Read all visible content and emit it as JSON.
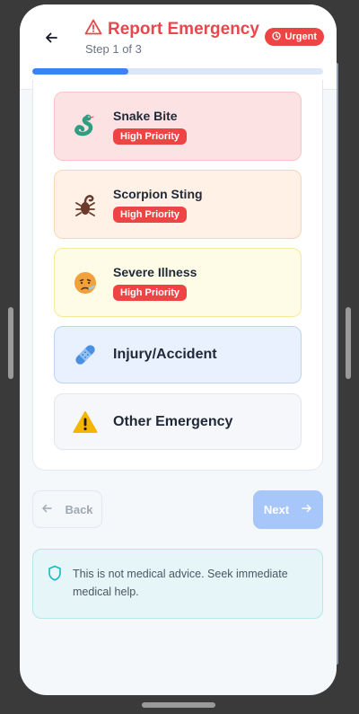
{
  "header": {
    "title": "Report Emergency",
    "step": "Step 1 of 3",
    "badge": "Urgent",
    "progress": 0.33
  },
  "options": [
    {
      "label": "Snake Bite",
      "priority": "High Priority",
      "icon": "snake-icon"
    },
    {
      "label": "Scorpion Sting",
      "priority": "High Priority",
      "icon": "scorpion-icon"
    },
    {
      "label": "Severe Illness",
      "priority": "High Priority",
      "icon": "sick-face-icon"
    },
    {
      "label": "Injury/Accident",
      "icon": "bandage-icon"
    },
    {
      "label": "Other Emergency",
      "icon": "warning-icon"
    }
  ],
  "nav": {
    "back_label": "Back",
    "next_label": "Next"
  },
  "disclaimer": {
    "text": "This is not medical advice. Seek immediate medical help.",
    "icon": "shield-icon"
  },
  "colors": {
    "accent_red": "#e5484d",
    "primary_blue": "#3b82f6",
    "next_disabled": "#a7c6fa"
  }
}
